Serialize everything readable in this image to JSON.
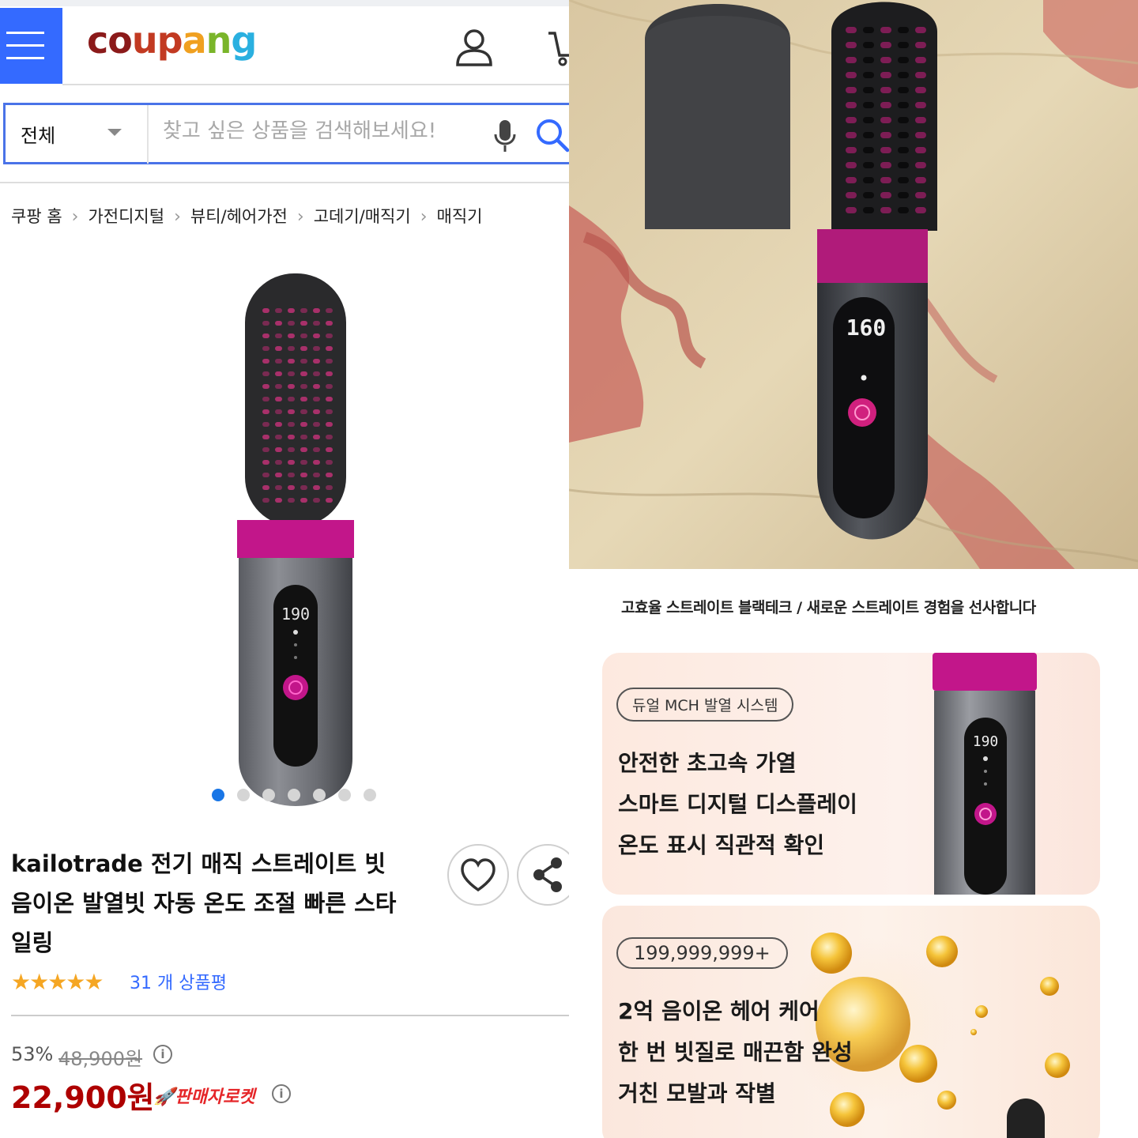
{
  "header": {
    "logo_text": "coupang",
    "logo_colors": [
      "#8b1a1a",
      "#c23a22",
      "#f0a020",
      "#7ab52a",
      "#2ab0e0"
    ]
  },
  "search": {
    "category_label": "전체",
    "placeholder": "찾고 싶은 상품을 검색해보세요!"
  },
  "breadcrumb": [
    "쿠팡 홈",
    "가전디지털",
    "뷰티/헤어가전",
    "고데기/매직기",
    "매직기"
  ],
  "product": {
    "display_reading": "190",
    "carousel": {
      "count": 7,
      "active_index": 0
    },
    "title": "kailotrade 전기 매직 스트레이트 빗 음이온 발열빗 자동 온도 조절 빠른 스타일링",
    "rating_stars": "★★★★★",
    "rating_value": 5,
    "review_text": "31 개 상품평",
    "discount_rate": "53%",
    "original_price": "48,900원",
    "price": "22,900원",
    "badge": "판매자로켓",
    "info_glyph": "i"
  },
  "photo": {
    "display_reading": "160"
  },
  "promo": {
    "headline": "고효율 스트레이트 블랙테크 / 새로운 스트레이트 경험을 선사합니다",
    "card1": {
      "pill": "듀얼 MCH 발열 시스템",
      "lines": [
        "안전한 초고속 가열",
        "스마트 디지털 디스플레이",
        "온도 표시 직관적 확인"
      ],
      "display_reading": "190"
    },
    "card2": {
      "pill": "199,999,999+",
      "lines": [
        "2억 음이온 헤어 케어",
        "한 번 빗질로 매끈함 완성",
        "거친 모발과 작별"
      ]
    }
  },
  "colors": {
    "accent_blue": "#346aff",
    "price_red": "#ae0000",
    "magenta": "#c2168a",
    "star": "#f5a623"
  }
}
